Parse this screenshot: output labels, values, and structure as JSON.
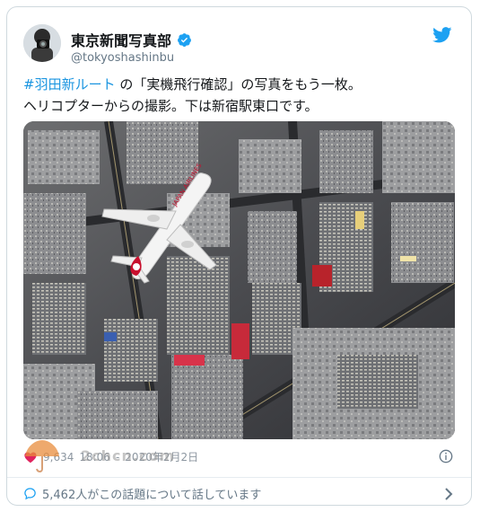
{
  "account": {
    "name": "東京新聞写真部",
    "handle": "@tokyoshashinbu"
  },
  "tweet": {
    "hashtag": "#羽田新ルート",
    "text_line1_rest": " の「実機飛行確認」の写真をもう一枚。",
    "text_line2": "ヘリコプターからの撮影。下は新宿駅東口です。"
  },
  "photo": {
    "aircraft_livery": "JAPAN AIRLINES"
  },
  "meta": {
    "likes": "9,634",
    "time": "18:06",
    "date": "2020年2月2日"
  },
  "conversation": {
    "text": "5,462人がこの話題について話しています"
  },
  "watermark": {
    "text": "2chcn.com"
  },
  "colors": {
    "link": "#1b95e0",
    "verified": "#1da1f2",
    "twitter_blue": "#1da1f2",
    "like_red": "#e0245e"
  },
  "icons": [
    "verified-badge-icon",
    "twitter-bird-icon",
    "heart-icon",
    "info-icon",
    "comment-icon",
    "chevron-right-icon"
  ]
}
